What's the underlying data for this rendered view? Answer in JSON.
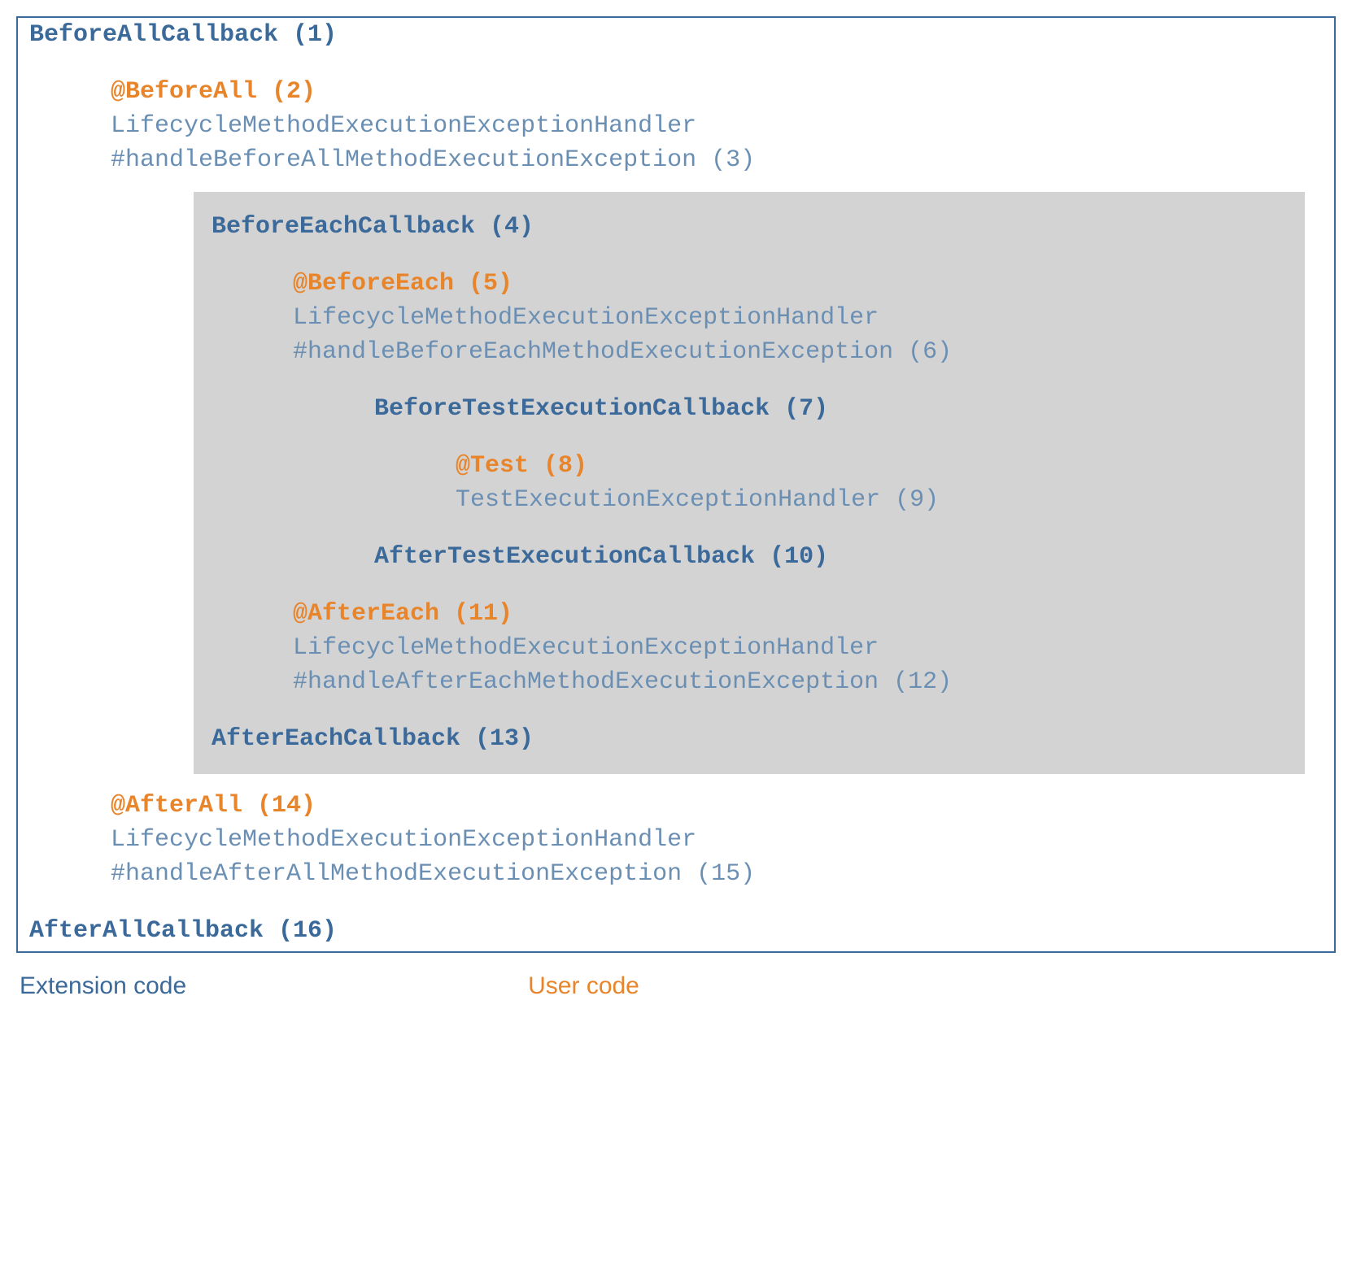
{
  "items": {
    "l1": "BeforeAllCallback (1)",
    "l2": "@BeforeAll (2)",
    "l3a": "LifecycleMethodExecutionExceptionHandler",
    "l3b": "#handleBeforeAllMethodExecutionException (3)",
    "l4": "BeforeEachCallback (4)",
    "l5": "@BeforeEach (5)",
    "l6a": "LifecycleMethodExecutionExceptionHandler",
    "l6b": "#handleBeforeEachMethodExecutionException (6)",
    "l7": "BeforeTestExecutionCallback (7)",
    "l8": "@Test (8)",
    "l9": "TestExecutionExceptionHandler (9)",
    "l10": "AfterTestExecutionCallback (10)",
    "l11": "@AfterEach (11)",
    "l12a": "LifecycleMethodExecutionExceptionHandler",
    "l12b": "#handleAfterEachMethodExecutionException (12)",
    "l13": "AfterEachCallback (13)",
    "l14": "@AfterAll (14)",
    "l15a": "LifecycleMethodExecutionExceptionHandler",
    "l15b": "#handleAfterAllMethodExecutionException (15)",
    "l16": "AfterAllCallback (16)"
  },
  "legend": {
    "extension": "Extension code",
    "user": "User code"
  }
}
